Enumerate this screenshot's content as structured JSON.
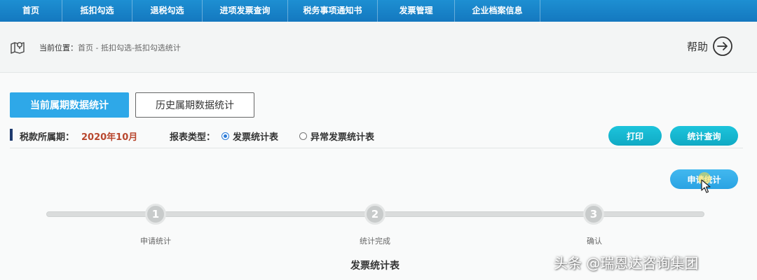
{
  "nav": {
    "items": [
      {
        "label": "首页"
      },
      {
        "label": "抵扣勾选"
      },
      {
        "label": "退税勾选"
      },
      {
        "label": "进项发票查询"
      },
      {
        "label": "税务事项通知书"
      },
      {
        "label": "发票管理"
      },
      {
        "label": "企业档案信息"
      }
    ]
  },
  "breadcrumb": {
    "prefix": "当前位置：",
    "path": "首页 - 抵扣勾选-抵扣勾选统计",
    "icon": "location-map-icon"
  },
  "help": {
    "label": "帮助",
    "icon": "arrow-right-circle-icon"
  },
  "tabs": [
    {
      "label": "当前属期数据统计",
      "active": true
    },
    {
      "label": "历史属期数据统计",
      "active": false
    }
  ],
  "filter": {
    "period_label": "税款所属期：",
    "period_value": "2020年10月",
    "type_label": "报表类型：",
    "options": [
      {
        "label": "发票统计表",
        "selected": true
      },
      {
        "label": "异常发票统计表",
        "selected": false
      }
    ]
  },
  "actions": {
    "print_label": "打印",
    "query_label": "统计查询",
    "apply_label": "申请统计"
  },
  "steps": [
    {
      "number": "1",
      "label": "申请统计"
    },
    {
      "number": "2",
      "label": "统计完成"
    },
    {
      "number": "3",
      "label": "确认"
    }
  ],
  "table": {
    "title": "发票统计表"
  },
  "watermark": "头条 @瑞恩达咨询集团",
  "colors": {
    "nav": "#1d8fd2",
    "accent": "#2ea8e8",
    "button": "#10aac4",
    "period": "#b8472e"
  }
}
